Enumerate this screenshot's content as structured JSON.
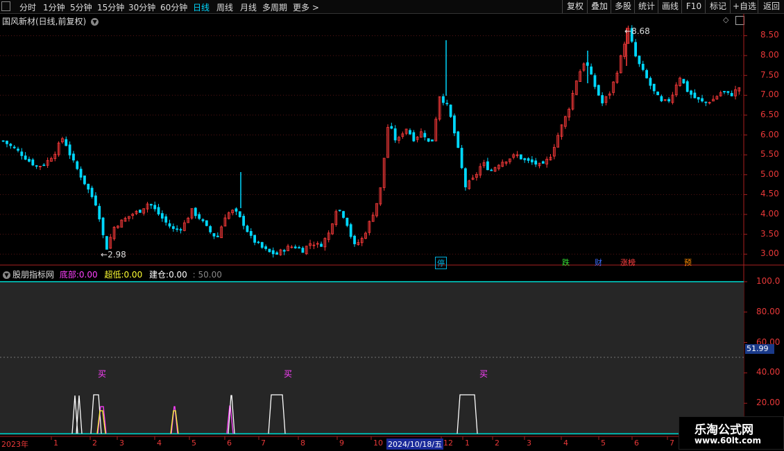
{
  "toolbar": {
    "periods": [
      "分时",
      "1分钟",
      "5分钟",
      "15分钟",
      "30分钟",
      "60分钟",
      "日线",
      "周线",
      "月线",
      "多周期",
      "更多 >"
    ],
    "active_period": "日线",
    "right_buttons": [
      "复权",
      "叠加",
      "多股",
      "统计",
      "画线",
      "F10",
      "标记",
      "+自选",
      "返回"
    ]
  },
  "main_chart": {
    "title": "国风新材(日线,前复权)",
    "high_marker": "8.68",
    "low_marker": "2.98",
    "price_ticks": [
      "8.50",
      "8.00",
      "7.50",
      "7.00",
      "6.50",
      "6.00",
      "5.50",
      "5.00",
      "4.50",
      "4.00",
      "3.50",
      "3.00"
    ],
    "event_tags": [
      {
        "text": "停",
        "color": "#00b0e0"
      },
      {
        "text": "跌",
        "color": "#33dd33"
      },
      {
        "text": "财",
        "color": "#3b6cff"
      },
      {
        "text": "涨榜",
        "color": "#ff4040"
      },
      {
        "text": "预",
        "color": "#ff8c00"
      }
    ],
    "up_color": "#ff3b3b",
    "down_color": "#00d8ff"
  },
  "indicator": {
    "name": "股朋指标网",
    "params": [
      {
        "label": "底部:",
        "value": "0.00",
        "color": "#ff40ff"
      },
      {
        "label": "超低:",
        "value": "0.00",
        "color": "#ffff33"
      },
      {
        "label": "建仓:",
        "value": "0.00",
        "color": "#ffffff"
      }
    ],
    "extra": ": 50.00",
    "ticks": [
      "100.0",
      "80.00",
      "60.00",
      "40.00",
      "20.00"
    ],
    "current_value": "51.99",
    "buy_labels": [
      "买",
      "买",
      "买"
    ]
  },
  "chart_data": {
    "type": "candlestick+indicator",
    "price_axis": {
      "min": 2.9,
      "max": 8.7
    },
    "annotations": {
      "high": 8.68,
      "low": 2.98
    },
    "close_series_approx": [
      5.85,
      5.7,
      5.55,
      5.35,
      5.2,
      5.3,
      5.55,
      5.95,
      5.4,
      5.0,
      4.6,
      4.2,
      3.1,
      3.7,
      3.85,
      4.0,
      4.1,
      4.3,
      4.05,
      3.8,
      3.6,
      3.7,
      4.1,
      3.9,
      3.6,
      3.4,
      4.0,
      4.1,
      3.8,
      3.4,
      3.2,
      3.05,
      3.0,
      3.15,
      3.2,
      3.1,
      3.3,
      3.2,
      3.5,
      4.2,
      3.9,
      3.2,
      3.4,
      3.9,
      4.5,
      6.3,
      5.8,
      6.2,
      5.9,
      6.1,
      5.7,
      7.0,
      6.7,
      5.8,
      4.7,
      4.9,
      5.3,
      5.1,
      5.3,
      5.4,
      5.5,
      5.35,
      5.3,
      5.2,
      5.5,
      6.1,
      6.6,
      7.4,
      7.9,
      7.3,
      6.8,
      7.1,
      7.8,
      8.68,
      7.9,
      7.5,
      7.1,
      6.8,
      6.9,
      7.5,
      7.1,
      6.9,
      6.8,
      6.9,
      7.1,
      7.0,
      7.2
    ],
    "indicator_axis": {
      "min": 0,
      "max": 100
    },
    "x_labels": [
      "2023年",
      "1",
      "2",
      "3",
      "4",
      "5",
      "6",
      "7",
      "8",
      "9",
      "10",
      "2024/10/18/五",
      "12",
      "1",
      "2",
      "3",
      "4",
      "5",
      "6",
      "7"
    ]
  },
  "watermark": {
    "title": "乐淘公式网",
    "url": "www.60lt.com"
  }
}
